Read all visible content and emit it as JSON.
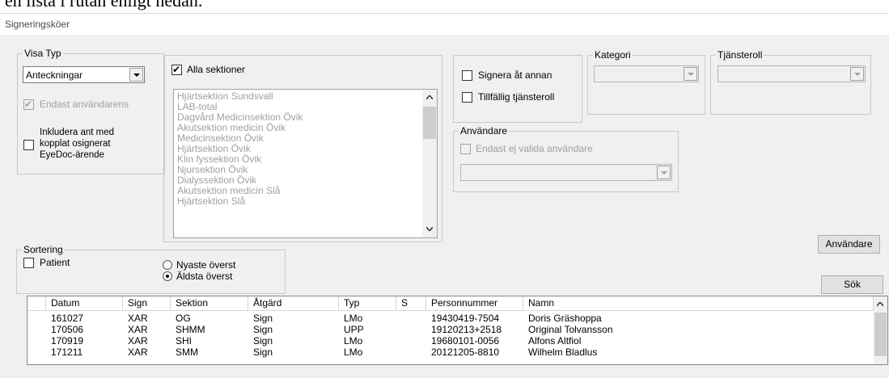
{
  "top_caption": "en lista i rutan enligt nedan.",
  "window_title": "Signeringsköer",
  "visa_typ": {
    "legend": "Visa Typ",
    "selected": "Anteckningar",
    "endast_label": "Endast användarens",
    "endast_checked": true,
    "include_label_lines": [
      "Inkludera ant med",
      "kopplat osignerat",
      "EyeDoc-ärende"
    ],
    "include_checked": false
  },
  "sections": {
    "all_label": "Alla sektioner",
    "all_checked": true,
    "items": [
      "Hjärtsektion Sundsvall",
      "LAB-total",
      "Dagvård Medicinsektion Övik",
      "Akutsektion medicin Övik",
      "Medicinsektion Övik",
      "Hjärtsektion Övik",
      "Klin fyssektion Övik",
      "Njursektion Övik",
      "Dialyssektion Övik",
      "Akutsektion medicin Slå",
      "Hjärtsektion Slå"
    ]
  },
  "options": {
    "signera_label": "Signera åt annan",
    "signera_checked": false,
    "tillfallig_label": "Tillfällig tjänsteroll",
    "tillfallig_checked": false
  },
  "kategori": {
    "legend": "Kategori",
    "value": ""
  },
  "tjansteroll": {
    "legend": "Tjänsteroll",
    "value": ""
  },
  "anvandare_group": {
    "legend": "Användare",
    "endast_label": "Endast ej valida användare",
    "endast_checked": false,
    "value": ""
  },
  "sortering": {
    "legend": "Sortering",
    "patient_label": "Patient",
    "patient_checked": false,
    "nyaste_label": "Nyaste överst",
    "aldsta_label": "Äldsta överst",
    "selected": "aldsta"
  },
  "buttons": {
    "anvandare": "Användare",
    "sok": "Sök"
  },
  "table": {
    "columns": [
      "",
      "Datum",
      "Sign",
      "Sektion",
      "Åtgärd",
      "Typ",
      "S",
      "Personnummer",
      "Namn"
    ],
    "rows": [
      [
        "",
        "161027",
        "XAR",
        "OG",
        "Sign",
        "LMo",
        "",
        "19430419-7504",
        "Doris Gräshoppa"
      ],
      [
        "",
        "170506",
        "XAR",
        "SHMM",
        "Sign",
        "UPP",
        "",
        "19120213+2518",
        "Original Tolvansson"
      ],
      [
        "",
        "170919",
        "XAR",
        "SHI",
        "Sign",
        "LMo",
        "",
        "19680101-0056",
        "Alfons Altfiol"
      ],
      [
        "",
        "171211",
        "XAR",
        "SMM",
        "Sign",
        "LMo",
        "",
        "20121205-8810",
        "Wilhelm Bladlus"
      ]
    ]
  },
  "colors": {
    "window_bg": "#f0f0f0",
    "disabled_text": "#a0a0a0",
    "border": "#c8c8c8"
  }
}
